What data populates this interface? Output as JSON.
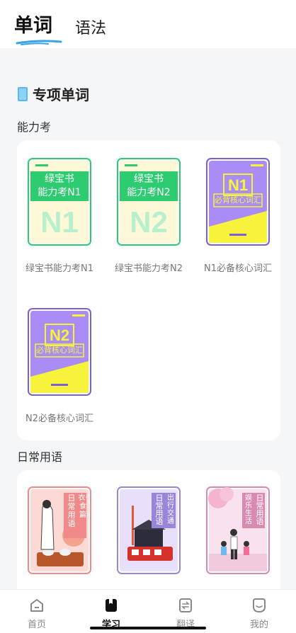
{
  "tabs": {
    "active": "单词",
    "inactive": "语法"
  },
  "section": {
    "title": "专项单词"
  },
  "groups": [
    {
      "label": "能力考",
      "items": [
        {
          "caption": "绿宝书能力考N1",
          "cover_title": "绿宝书",
          "cover_sub": "能力考N1",
          "cover_big": "N1"
        },
        {
          "caption": "绿宝书能力考N2",
          "cover_title": "绿宝书",
          "cover_sub": "能力考N2",
          "cover_big": "N2"
        },
        {
          "caption": "N1必备核心词汇",
          "cover_big": "N1",
          "cover_sub": "必背核心词汇"
        },
        {
          "caption": "N2必备核心词汇",
          "cover_big": "N2",
          "cover_sub": "必背核心词汇"
        }
      ]
    },
    {
      "label": "日常用语",
      "items": [
        {
          "cover_tag_1": "日常用语",
          "cover_tag_2": "衣·食篇"
        },
        {
          "cover_tag_1": "日常用语",
          "cover_tag_2": "出行交通"
        },
        {
          "cover_tag_1": "日常用语",
          "cover_tag_2": "娱乐生活"
        }
      ]
    }
  ],
  "nav": [
    {
      "label": "首页",
      "icon": "home-icon"
    },
    {
      "label": "学习",
      "icon": "study-icon"
    },
    {
      "label": "翻译",
      "icon": "translate-icon"
    },
    {
      "label": "我的",
      "icon": "profile-icon"
    }
  ],
  "colors": {
    "green": "#2ecc71",
    "purple": "#a98cf5",
    "yellow": "#f7f33a",
    "accent_blue": "#3aa3e6"
  }
}
